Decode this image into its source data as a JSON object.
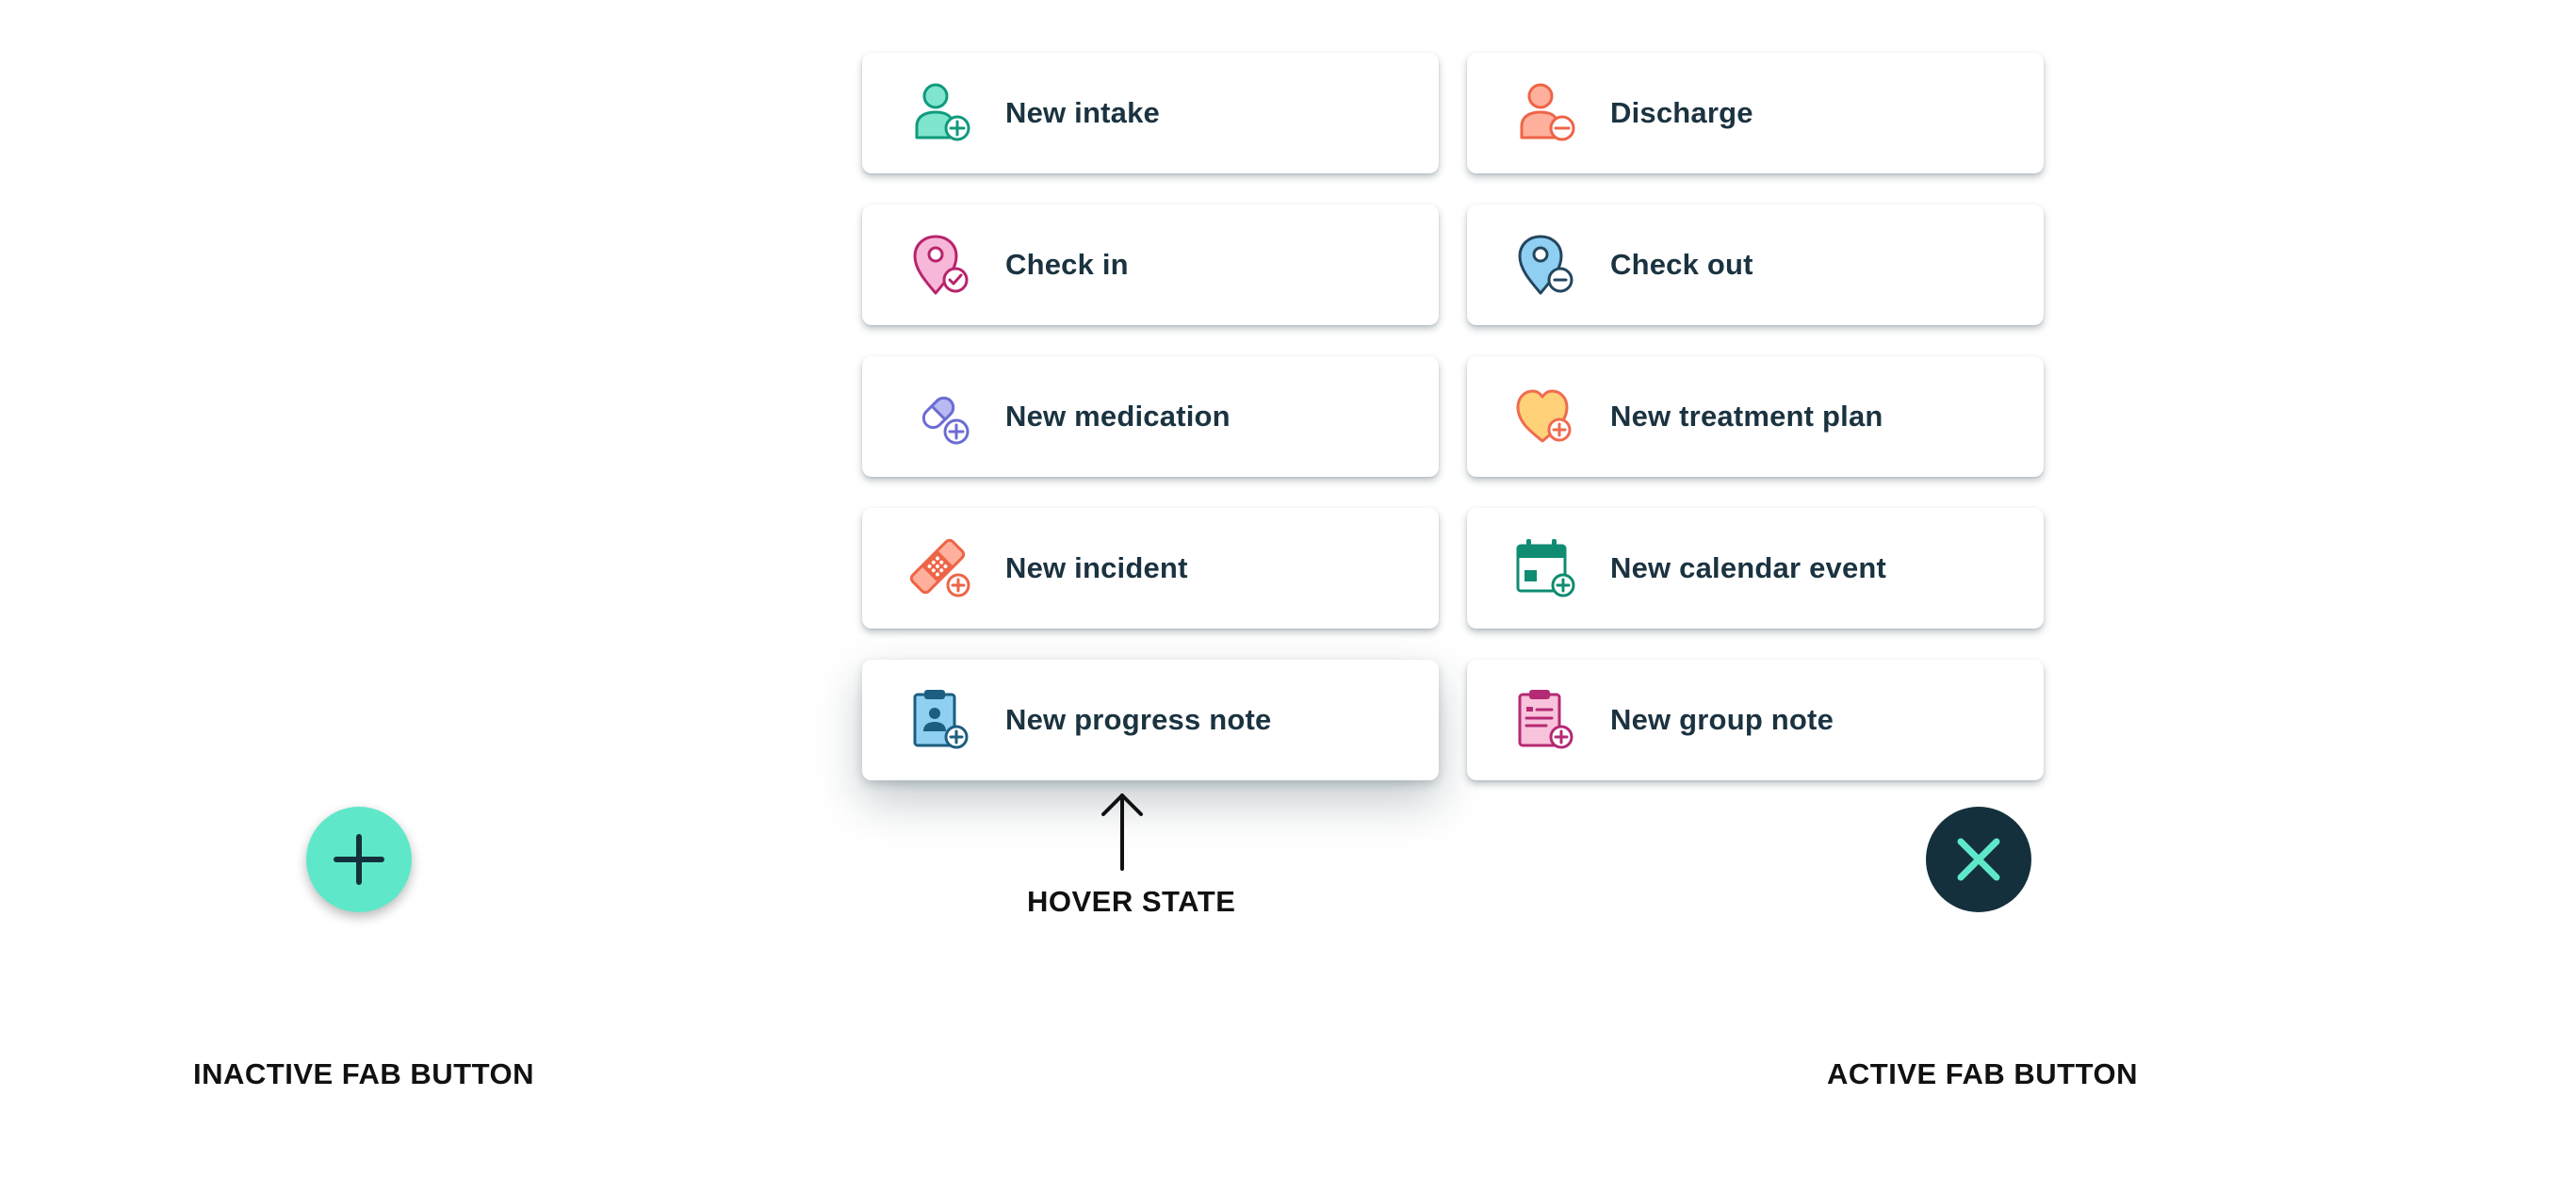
{
  "menu": {
    "items": [
      {
        "label": "New intake",
        "icon": "person-add-icon",
        "color": "#1fa589"
      },
      {
        "label": "Discharge",
        "icon": "person-remove-icon",
        "color": "#ef6a4c"
      },
      {
        "label": "Check in",
        "icon": "location-check-icon",
        "color": "#c52a78"
      },
      {
        "label": "Check out",
        "icon": "location-remove-icon",
        "color": "#2a4f6b"
      },
      {
        "label": "New medication",
        "icon": "pill-add-icon",
        "color": "#6e6fd6"
      },
      {
        "label": "New treatment plan",
        "icon": "heart-add-icon",
        "color": "#f06b4e"
      },
      {
        "label": "New incident",
        "icon": "bandage-add-icon",
        "color": "#ef6a4c"
      },
      {
        "label": "New calendar event",
        "icon": "calendar-add-icon",
        "color": "#0f8c72"
      },
      {
        "label": "New progress note",
        "icon": "clipboard-person-add-icon",
        "color": "#1c5e80",
        "state": "hover"
      },
      {
        "label": "New group note",
        "icon": "clipboard-note-add-icon",
        "color": "#b42a73"
      }
    ]
  },
  "annotations": {
    "hover_state": "HOVER STATE",
    "inactive_fab": "INACTIVE FAB BUTTON",
    "active_fab": "ACTIVE FAB BUTTON"
  },
  "fab": {
    "inactive_icon": "plus-icon",
    "active_icon": "close-icon",
    "inactive_color": "#5ee8c9",
    "active_color": "#14303c"
  }
}
